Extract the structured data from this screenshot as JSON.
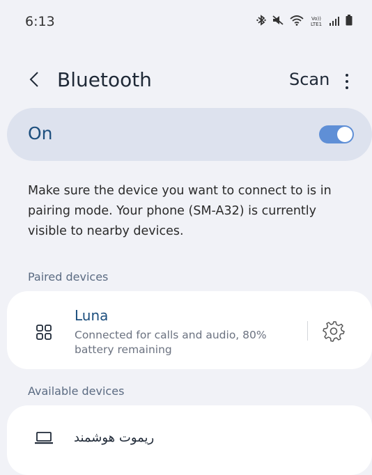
{
  "status_bar": {
    "time": "6:13",
    "icons": [
      "bluetooth-icon",
      "mute-icon",
      "wifi-icon",
      "volte-icon",
      "signal-icon",
      "battery-icon"
    ],
    "volte_label": "Vo)) LTE1"
  },
  "header": {
    "title": "Bluetooth",
    "scan_label": "Scan"
  },
  "toggle": {
    "label": "On",
    "state": true,
    "accent_color": "#5f8fd6"
  },
  "description": "Make sure the device you want to connect to is in pairing mode. Your phone (SM-A32) is currently visible to nearby devices.",
  "paired": {
    "header": "Paired devices",
    "devices": [
      {
        "name": "Luna",
        "status": "Connected for calls and audio, 80% battery remaining",
        "icon": "multi-device-icon"
      }
    ]
  },
  "available": {
    "header": "Available devices",
    "devices": [
      {
        "name": "ریموت هوشمند",
        "icon": "laptop-icon"
      }
    ]
  },
  "colors": {
    "background": "#f1f2f7",
    "card": "#ffffff",
    "toggle_card": "#dde2ee",
    "primary_text": "#1d4f7e",
    "section_text": "#5b6b82"
  }
}
